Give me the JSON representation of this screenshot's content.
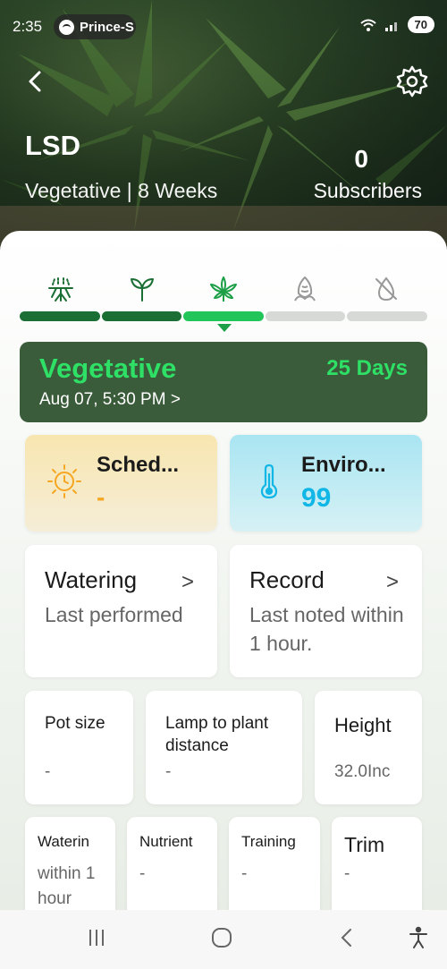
{
  "status_bar": {
    "time": "2:35",
    "spotify_label": "Prince-S",
    "battery": "70"
  },
  "plant": {
    "name": "LSD",
    "stage_line": "Vegetative | 8 Weeks",
    "subscribers_count": "0",
    "subscribers_label": "Subscribers"
  },
  "stages": [
    {
      "icon": "roots-icon",
      "status": "done"
    },
    {
      "icon": "seedling-icon",
      "status": "done"
    },
    {
      "icon": "cannabis-leaf-icon",
      "status": "current"
    },
    {
      "icon": "flower-bud-icon",
      "status": "upcoming"
    },
    {
      "icon": "no-water-icon",
      "status": "upcoming"
    }
  ],
  "stage_card": {
    "title": "Vegetative",
    "days": "25 Days",
    "date": "Aug 07, 5:30 PM >"
  },
  "schedule": {
    "title": "Sched...",
    "value": "-"
  },
  "environment": {
    "title": "Enviro...",
    "value": "99"
  },
  "watering": {
    "title": "Watering",
    "chevron": ">",
    "sub": "Last performed"
  },
  "record": {
    "title": "Record",
    "chevron": ">",
    "sub": "Last noted within 1 hour."
  },
  "pot_size": {
    "title": "Pot size",
    "value": "-"
  },
  "lamp": {
    "title": "Lamp to plant distance",
    "value": "-"
  },
  "height": {
    "title": "Height",
    "value": "32.0Inc"
  },
  "small_cards": [
    {
      "title": "Waterin",
      "value": "within 1 hour"
    },
    {
      "title": "Nutrient",
      "value": "-"
    },
    {
      "title": "Training",
      "value": "-"
    },
    {
      "title": "Trim",
      "value": "-"
    }
  ],
  "colors": {
    "done": "#1c6f34",
    "current": "#22c55a",
    "upcoming": "#d7d9d7",
    "stage_card_bg": "#3a5c3a",
    "accent_green": "#2ee065",
    "schedule_value": "#f5a623",
    "environment_value": "#10b6e6"
  }
}
